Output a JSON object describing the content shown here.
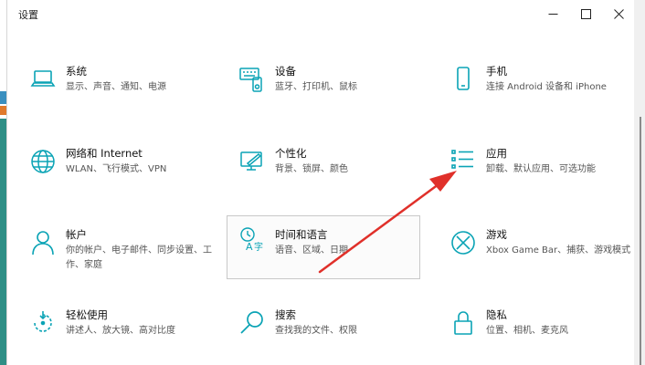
{
  "window": {
    "title": "设置",
    "minimize_icon": "minimize-icon",
    "maximize_icon": "maximize-icon",
    "close_icon": "close-icon"
  },
  "accent_color": "#0aa3b5",
  "annotation_color": "#e0302a",
  "tiles": [
    {
      "title": "系统",
      "desc": "显示、声音、通知、电源",
      "icon": "laptop-icon"
    },
    {
      "title": "设备",
      "desc": "蓝牙、打印机、鼠标",
      "icon": "keyboard-icon"
    },
    {
      "title": "手机",
      "desc": "连接 Android 设备和 iPhone",
      "icon": "phone-icon"
    },
    {
      "title": "网络和 Internet",
      "desc": "WLAN、飞行模式、VPN",
      "icon": "globe-icon"
    },
    {
      "title": "个性化",
      "desc": "背景、锁屏、颜色",
      "icon": "paint-icon"
    },
    {
      "title": "应用",
      "desc": "卸载、默认应用、可选功能",
      "icon": "apps-list-icon"
    },
    {
      "title": "帐户",
      "desc": "你的帐户、电子邮件、同步设置、工作、家庭",
      "icon": "person-icon"
    },
    {
      "title": "时间和语言",
      "desc": "语音、区域、日期",
      "icon": "time-language-icon"
    },
    {
      "title": "游戏",
      "desc": "Xbox Game Bar、捕获、游戏模式",
      "icon": "xbox-icon"
    },
    {
      "title": "轻松使用",
      "desc": "讲述人、放大镜、高对比度",
      "icon": "ease-of-access-icon"
    },
    {
      "title": "搜索",
      "desc": "查找我的文件、权限",
      "icon": "search-icon"
    },
    {
      "title": "隐私",
      "desc": "位置、相机、麦克风",
      "icon": "lock-icon"
    }
  ]
}
